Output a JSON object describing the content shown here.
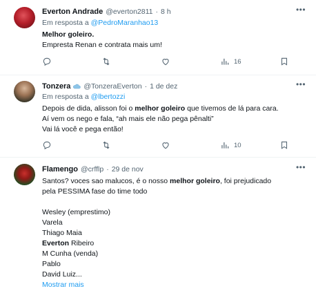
{
  "tweets": [
    {
      "name": "Everton Andrade",
      "handle": "@everton2811",
      "sep": "·",
      "time": "8 h",
      "reply_prefix": "Em resposta a",
      "reply_to": "@PedroMaranhao13",
      "lines": [
        "Melhor goleiro.",
        "Empresta Renan e contrata mais um!"
      ],
      "actions": {
        "reply": "",
        "retweet": "",
        "like": "",
        "views": "16",
        "bookmark": ""
      }
    },
    {
      "name": "Tonzera",
      "handle": "@TonzeraEverton",
      "sep": "·",
      "time": "1 de dez",
      "reply_prefix": "Em resposta a",
      "reply_to": "@lbertozzi",
      "line1_pre": "Depois de dida, alisson foi o ",
      "line1_bold": "melhor goleiro",
      "line1_post": " que tivemos de lá para cara.",
      "line2": "Aí vem os nego e fala, “ah mais ele não pega pênalti”",
      "line3": "Vai lá você e pega então!",
      "actions": {
        "reply": "",
        "retweet": "",
        "like": "",
        "views": "10",
        "bookmark": ""
      }
    },
    {
      "name": "Flamengo",
      "handle": "@crfflp",
      "sep": "·",
      "time": "29 de nov",
      "line1_pre": "Santos? voces sao malucos, é o nosso ",
      "line1_bold": "melhor goleiro",
      "line1_post": ", foi prejudicado",
      "line2": "pela PESSIMA fase do time todo",
      "list": [
        "Wesley (emprestimo)",
        "Varela",
        "Thiago Maia"
      ],
      "everton_bold": "Everton",
      "everton_rest": " Ribeiro",
      "list2": [
        "M Cunha (venda)",
        "Pablo",
        "David Luiz..."
      ],
      "show_more": "Mostrar mais"
    }
  ],
  "colors": {
    "link": "#1d9bf0",
    "muted": "#536471",
    "text": "#0f1419",
    "divider": "#eff3f4"
  }
}
